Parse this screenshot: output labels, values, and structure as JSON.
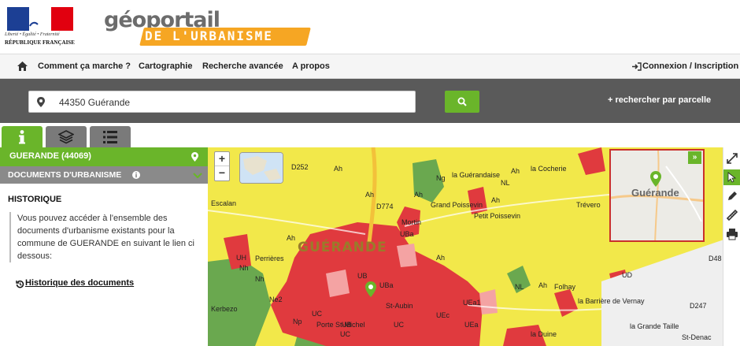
{
  "header": {
    "motto": "Liberté • Égalité • Fraternité",
    "republic": "RÉPUBLIQUE FRANÇAISE",
    "logo_word": "géoportail",
    "logo_sub": "DE L'URBANISME"
  },
  "nav": {
    "items": [
      "Comment ça marche ?",
      "Cartographie",
      "Recherche avancée",
      "A propos"
    ],
    "login": "Connexion / Inscription"
  },
  "search": {
    "value": "44350 Guérande",
    "parcel_link": "+ rechercher par parcelle"
  },
  "sidebar": {
    "commune": "GUERANDE (44069)",
    "section": "DOCUMENTS D'URBANISME",
    "history_title": "HISTORIQUE",
    "history_text": "Vous pouvez accéder à l'ensemble des documents d'urbanisme existants pour la commune de GUERANDE en suivant le lien ci dessous:",
    "history_link": "Historique des documents"
  },
  "map": {
    "town_label": "GUÉRANDE",
    "overview_label": "Guérande",
    "overview_toggle": "»",
    "zoom_in": "+",
    "zoom_out": "−",
    "labels": [
      "Ah",
      "Ah",
      "Ah",
      "Ah",
      "Ah",
      "Ah",
      "Ah",
      "Ah",
      "Ng",
      "Nh",
      "Nh",
      "NL",
      "NL",
      "UB",
      "UBa",
      "UB",
      "UBa",
      "UC",
      "UC",
      "UC",
      "UEa",
      "UEa1",
      "UEc",
      "UH",
      "UD",
      "Ne2",
      "Np",
      "Mortin",
      "la Guérandaise",
      "Grand Poissevin",
      "Petit Poissevin",
      "Trévero",
      "la Cocherie",
      "Perrières",
      "Folhay",
      "la Barrière de Vernay",
      "la Duine",
      "la Grande Taille",
      "St-Denac",
      "D48",
      "D247",
      "D252",
      "D774",
      "Escalan",
      "Kerbezo",
      "Porte St-Michel",
      "St-Aubin"
    ]
  },
  "colors": {
    "brand_green": "#6ab52a",
    "gray_band": "#5a5a5a",
    "zone_yellow": "#f2e84a",
    "zone_red": "#e03a3e",
    "zone_green": "#6aa84f"
  }
}
